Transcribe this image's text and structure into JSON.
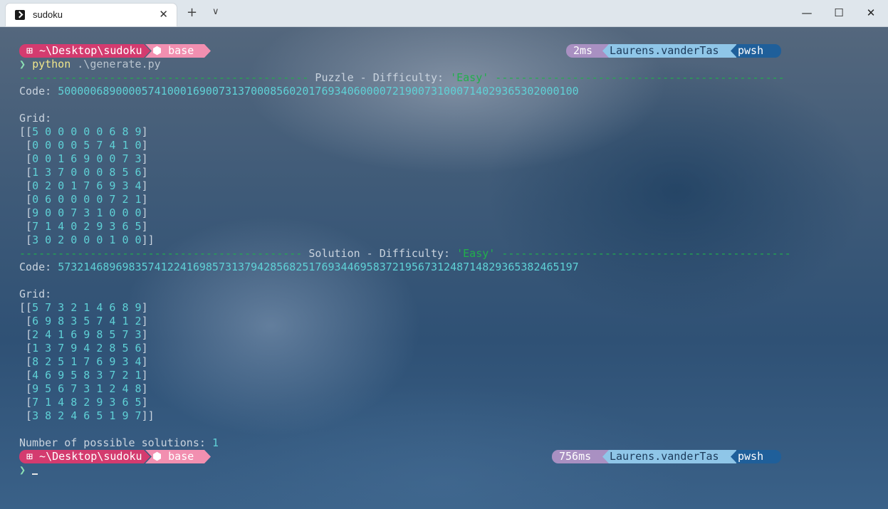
{
  "window": {
    "tab_title": "sudoku",
    "tab_close_glyph": "✕",
    "new_tab_glyph": "+",
    "dropdown_glyph": "∨",
    "minimize_glyph": "—",
    "maximize_glyph": "☐",
    "close_glyph": "✕"
  },
  "prompt1": {
    "path": "⊞ ~\\Desktop\\sudoku",
    "env": "⬢ base",
    "time": "2ms",
    "user": "Laurens.vanderTas",
    "shell": "pwsh"
  },
  "command": {
    "chevron": "❯",
    "program": "python",
    "args": " .\\generate.py"
  },
  "puzzle": {
    "separator_left": "---------------------------------------------",
    "title": " Puzzle - Difficulty: ",
    "difficulty": "'Easy'",
    "separator_right": " ---------------------------------------------",
    "code_label": "Code: ",
    "code": "500000689000057410001690073137000856020176934060000721900731000714029365302000100",
    "grid_label": "Grid:",
    "rows": [
      [
        "[[",
        "5 0 0 0 0 0 6 8 9",
        "]"
      ],
      [
        " [",
        "0 0 0 0 5 7 4 1 0",
        "]"
      ],
      [
        " [",
        "0 0 1 6 9 0 0 7 3",
        "]"
      ],
      [
        " [",
        "1 3 7 0 0 0 8 5 6",
        "]"
      ],
      [
        " [",
        "0 2 0 1 7 6 9 3 4",
        "]"
      ],
      [
        " [",
        "0 6 0 0 0 0 7 2 1",
        "]"
      ],
      [
        " [",
        "9 0 0 7 3 1 0 0 0",
        "]"
      ],
      [
        " [",
        "7 1 4 0 2 9 3 6 5",
        "]"
      ],
      [
        " [",
        "3 0 2 0 0 0 1 0 0",
        "]]"
      ]
    ]
  },
  "solution": {
    "separator_left": "--------------------------------------------",
    "title": " Solution - Difficulty: ",
    "difficulty": "'Easy'",
    "separator_right": " ---------------------------------------------",
    "code_label": "Code: ",
    "code": "573214689698357412241698573137942856825176934469583721956731248714829365382465197",
    "grid_label": "Grid:",
    "rows": [
      [
        "[[",
        "5 7 3 2 1 4 6 8 9",
        "]"
      ],
      [
        " [",
        "6 9 8 3 5 7 4 1 2",
        "]"
      ],
      [
        " [",
        "2 4 1 6 9 8 5 7 3",
        "]"
      ],
      [
        " [",
        "1 3 7 9 4 2 8 5 6",
        "]"
      ],
      [
        " [",
        "8 2 5 1 7 6 9 3 4",
        "]"
      ],
      [
        " [",
        "4 6 9 5 8 3 7 2 1",
        "]"
      ],
      [
        " [",
        "9 5 6 7 3 1 2 4 8",
        "]"
      ],
      [
        " [",
        "7 1 4 8 2 9 3 6 5",
        "]"
      ],
      [
        " [",
        "3 8 2 4 6 5 1 9 7",
        "]]"
      ]
    ]
  },
  "result": {
    "label": "Number of possible solutions: ",
    "count": "1"
  },
  "prompt2": {
    "path": "⊞ ~\\Desktop\\sudoku",
    "env": "⬢ base",
    "time": "756ms",
    "user": "Laurens.vanderTas",
    "shell": "pwsh",
    "chevron": "❯"
  }
}
